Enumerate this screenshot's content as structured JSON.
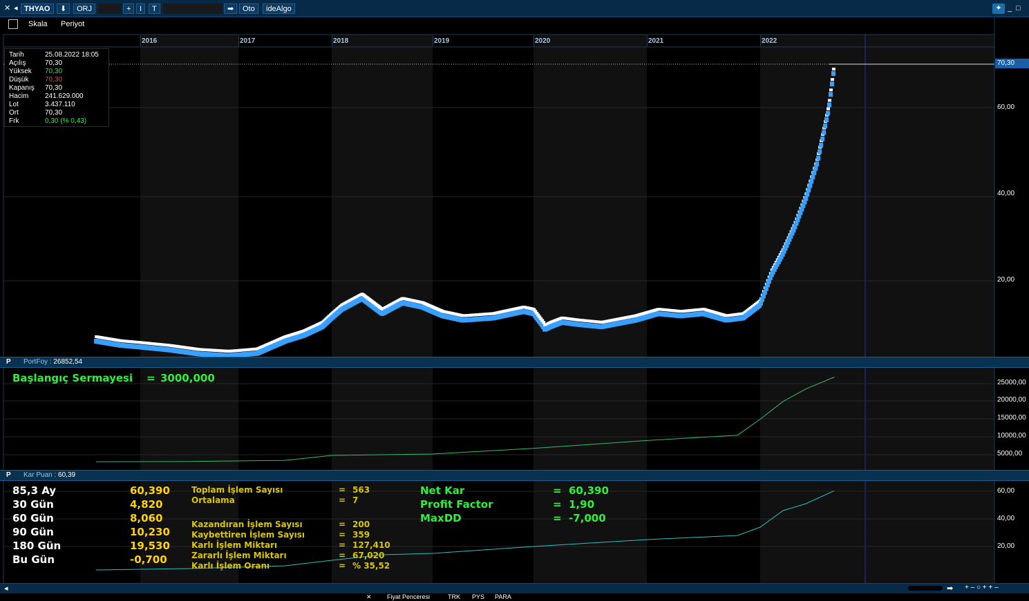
{
  "topbar": {
    "close_label": "✕",
    "symbol": "THYAO",
    "download_label": "⬇",
    "orj_label": "ORJ",
    "plus_label": "+",
    "bar_label": "I",
    "t_label": "T",
    "arrow_label": "➡",
    "oto_label": "Oto",
    "idealgo_label": "ideAlgo"
  },
  "toolbar": {
    "save_icon": "floppy",
    "skala_label": "Skala",
    "periyot_label": "Periyot"
  },
  "years": [
    "2016",
    "2017",
    "2018",
    "2019",
    "2020",
    "2021",
    "2022"
  ],
  "info": {
    "rows": [
      {
        "label": "Tarih",
        "value": "25.08.2022 18:05",
        "color": "#ffffff"
      },
      {
        "label": "Açılış",
        "value": "70,30",
        "color": "#ffffff"
      },
      {
        "label": "Yüksek",
        "value": "70,30",
        "color": "#2ef03c"
      },
      {
        "label": "Düşük",
        "value": "70,30",
        "color": "#ff3b3b"
      },
      {
        "label": "Kapanış",
        "value": "70,30",
        "color": "#ffffff"
      },
      {
        "label": "Hacim",
        "value": "241.629.000",
        "color": "#ffffff"
      },
      {
        "label": "Lot",
        "value": "3.437.110",
        "color": "#ffffff"
      },
      {
        "label": "Ort",
        "value": "70,30",
        "color": "#ffffff"
      },
      {
        "label": "Frk",
        "value": "0,30 (% 0,43)",
        "color": "#2ef03c"
      }
    ]
  },
  "price_axis": {
    "last_price": "70,30",
    "labels": [
      "60,00",
      "40,00",
      "20,00"
    ]
  },
  "portfoy_panel": {
    "p_label": "P",
    "title": "PortFoy :",
    "value": "26852,54",
    "start_capital_label": "Başlangıç Sermayesi",
    "start_capital_eq": "=",
    "start_capital_value": "3000,000",
    "axis_labels": [
      "25000,00",
      "20000,00",
      "15000,00",
      "10000,00",
      "5000,00"
    ]
  },
  "kar_panel": {
    "p_label": "P",
    "title": "Kar Puan :",
    "value": "60,39",
    "periods": [
      {
        "label": "85,3 Ay",
        "value": "60,390"
      },
      {
        "label": "30 Gün",
        "value": "4,820"
      },
      {
        "label": "60 Gün",
        "value": "8,060"
      },
      {
        "label": "90 Gün",
        "value": "10,230"
      },
      {
        "label": "180 Gün",
        "value": "19,530"
      },
      {
        "label": "Bu Gün",
        "value": "-0,700"
      }
    ],
    "stats": [
      {
        "label": "Toplam İşlem Sayısı",
        "eq": "=",
        "value": "563"
      },
      {
        "label": "Ortalama",
        "eq": "=",
        "value": "7"
      },
      {
        "label": "Kazandıran İşlem Sayısı",
        "eq": "=",
        "value": "200"
      },
      {
        "label": "Kaybettiren İşlem Sayısı",
        "eq": "=",
        "value": "359"
      },
      {
        "label": "Karlı İşlem Miktarı",
        "eq": "=",
        "value": "127,410"
      },
      {
        "label": "Zararlı İşlem Miktarı",
        "eq": "=",
        "value": "67,020"
      },
      {
        "label": "Karlı İşlem Oranı",
        "eq": "=",
        "value": "% 35,52"
      }
    ],
    "summary": [
      {
        "label": "Net Kar",
        "eq": "=",
        "value": "60,390"
      },
      {
        "label": "Profit Factor",
        "eq": "=",
        "value": "1,90"
      },
      {
        "label": "MaxDD",
        "eq": "=",
        "value": "-7,000"
      }
    ],
    "axis_labels": [
      "60,00",
      "40,00",
      "20,00"
    ]
  },
  "tabs": [
    "Fiyat Penceresi",
    "TRK",
    "PYS",
    "PARA"
  ],
  "colors": {
    "candle_up": "#3aa0ff",
    "candle_white": "#ffffff",
    "equity": "#2fbf6a",
    "kar": "#29c2c2",
    "panel_bg": "#08324f"
  },
  "chart_data": [
    {
      "type": "line",
      "title": "THYAO",
      "x": [
        2015.55,
        2015.8,
        2016.0,
        2016.3,
        2016.6,
        2016.9,
        2017.2,
        2017.5,
        2017.7,
        2017.9,
        2018.1,
        2018.3,
        2018.5,
        2018.7,
        2018.9,
        2019.1,
        2019.3,
        2019.6,
        2019.9,
        2020.0,
        2020.1,
        2020.25,
        2020.4,
        2020.6,
        2020.9,
        2021.1,
        2021.3,
        2021.5,
        2021.7,
        2021.85,
        2022.0,
        2022.1,
        2022.2,
        2022.3,
        2022.4,
        2022.5,
        2022.6,
        2022.65
      ],
      "y": [
        7.5,
        6.8,
        6.5,
        6.0,
        5.3,
        5.0,
        5.4,
        7.5,
        8.5,
        10.0,
        14.0,
        16.5,
        13.0,
        15.5,
        14.5,
        12.5,
        11.5,
        12.0,
        13.5,
        13.0,
        9.5,
        11.0,
        10.5,
        10.0,
        11.5,
        13.0,
        12.5,
        13.0,
        11.5,
        12.0,
        15.0,
        22.0,
        27.0,
        33.0,
        40.0,
        48.0,
        60.0,
        70.3
      ],
      "ylim": [
        0,
        80
      ]
    },
    {
      "type": "line",
      "title": "PortFoy",
      "x": [
        2015.55,
        2016.5,
        2017.5,
        2018.0,
        2019.0,
        2020.0,
        2021.0,
        2021.8,
        2022.0,
        2022.2,
        2022.4,
        2022.65
      ],
      "y": [
        3000,
        3100,
        3400,
        4800,
        5200,
        6800,
        9000,
        10500,
        15000,
        20000,
        23500,
        26852.54
      ],
      "ylim": [
        0,
        28000
      ]
    },
    {
      "type": "line",
      "title": "Kar Puan",
      "x": [
        2015.55,
        2016.5,
        2017.5,
        2018.0,
        2018.5,
        2019.0,
        2020.0,
        2021.0,
        2021.8,
        2022.0,
        2022.2,
        2022.4,
        2022.65
      ],
      "y": [
        3,
        4,
        6,
        10,
        14,
        15,
        20,
        25,
        28,
        34,
        46,
        51,
        60.39
      ],
      "ylim": [
        0,
        70
      ]
    }
  ]
}
